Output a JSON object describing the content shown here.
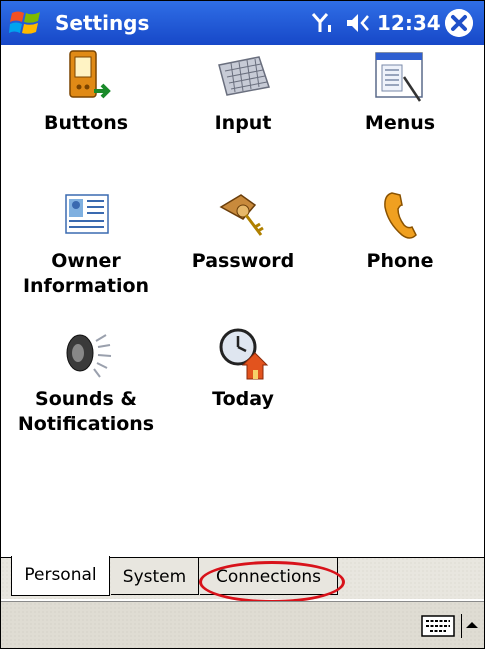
{
  "titlebar": {
    "title": "Settings",
    "time": "12:34",
    "icons": [
      "windows-start-icon",
      "signal-icon",
      "volume-icon",
      "close-icon"
    ]
  },
  "items": [
    {
      "label": "Buttons",
      "icon": "buttons-icon"
    },
    {
      "label": "Input",
      "icon": "keyboard-icon"
    },
    {
      "label": "Menus",
      "icon": "menus-icon"
    },
    {
      "label": "Owner\nInformation",
      "icon": "owner-card-icon"
    },
    {
      "label": "Password",
      "icon": "keys-icon"
    },
    {
      "label": "Phone",
      "icon": "phone-icon"
    },
    {
      "label": "Sounds &\nNotifications",
      "icon": "speaker-icon"
    },
    {
      "label": "Today",
      "icon": "clock-home-icon"
    }
  ],
  "tabs": [
    {
      "label": "Personal",
      "active": true
    },
    {
      "label": "System",
      "active": false
    },
    {
      "label": "Connections",
      "active": false
    }
  ],
  "colors": {
    "titlebar": "#1f56d8",
    "highlight": "#d8121a"
  }
}
